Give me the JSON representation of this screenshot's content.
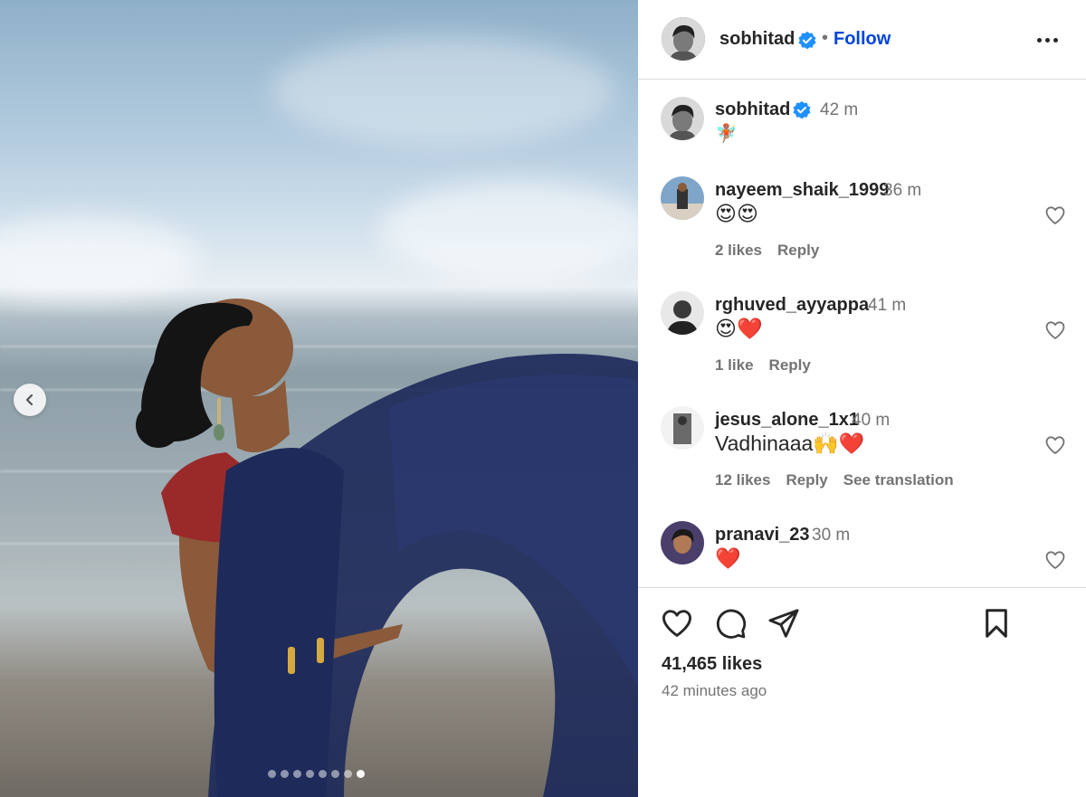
{
  "post": {
    "author": "sobhitad",
    "follow_label": "Follow",
    "separator": "•",
    "caption_emoji": "🧚🏽",
    "caption_time": "42 m"
  },
  "carousel": {
    "slide_count": 8,
    "active_index": 7
  },
  "comments": [
    {
      "user": "nayeem_shaik_1999",
      "time": "36 m",
      "text": "😍😍",
      "likes": "2 likes",
      "reply": "Reply",
      "translate": ""
    },
    {
      "user": "rghuved_ayyappa",
      "time": "41 m",
      "text": "😍❤️",
      "likes": "1 like",
      "reply": "Reply",
      "translate": ""
    },
    {
      "user": "jesus_alone_1x1",
      "time": "40 m",
      "text": "Vadhinaaa🙌❤️",
      "likes": "12 likes",
      "reply": "Reply",
      "translate": "See translation"
    },
    {
      "user": "pranavi_23",
      "time": "30 m",
      "text": "❤️",
      "likes": "",
      "reply": "",
      "translate": ""
    }
  ],
  "footer": {
    "likes_count": "41,465 likes",
    "time_ago": "42 minutes ago"
  },
  "icons": {
    "verified": "verified-badge-icon",
    "more": "more-options-icon",
    "like": "heart-icon",
    "comment": "comment-bubble-icon",
    "share": "paper-plane-icon",
    "save": "bookmark-icon",
    "prev": "chevron-left-icon"
  },
  "colors": {
    "accent": "#0044dd",
    "verified": "#1e90ff",
    "muted": "#737373",
    "saree": "#1e2a5a",
    "blouse": "#9a2a2a"
  }
}
